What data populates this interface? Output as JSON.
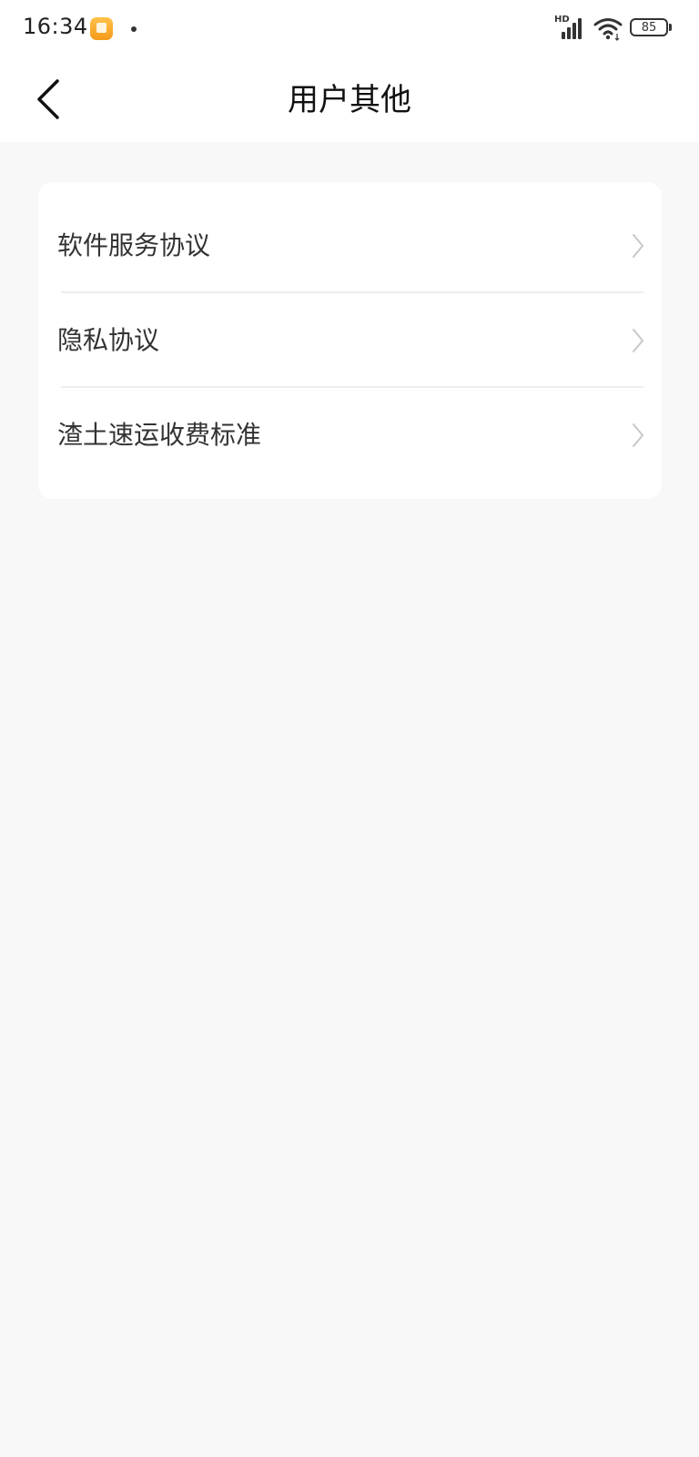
{
  "status_bar": {
    "time": "16:34",
    "network": "HD",
    "battery": "85"
  },
  "header": {
    "title": "用户其他"
  },
  "menu": {
    "items": [
      {
        "label": "软件服务协议"
      },
      {
        "label": "隐私协议"
      },
      {
        "label": "渣土速运收费标准"
      }
    ]
  },
  "colors": {
    "background": "#f8f8f8",
    "card": "#ffffff",
    "text": "#333333",
    "chevron": "#c8c8c8",
    "notification_icon": "#f7a928"
  }
}
